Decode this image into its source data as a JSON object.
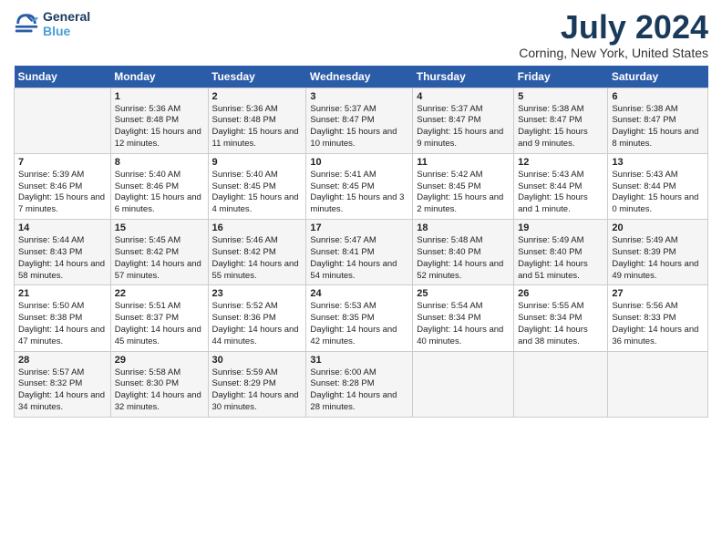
{
  "header": {
    "logo_line1": "General",
    "logo_line2": "Blue",
    "title": "July 2024",
    "subtitle": "Corning, New York, United States"
  },
  "days_of_week": [
    "Sunday",
    "Monday",
    "Tuesday",
    "Wednesday",
    "Thursday",
    "Friday",
    "Saturday"
  ],
  "weeks": [
    [
      {
        "day": "",
        "sunrise": "",
        "sunset": "",
        "daylight": ""
      },
      {
        "day": "1",
        "sunrise": "Sunrise: 5:36 AM",
        "sunset": "Sunset: 8:48 PM",
        "daylight": "Daylight: 15 hours and 12 minutes."
      },
      {
        "day": "2",
        "sunrise": "Sunrise: 5:36 AM",
        "sunset": "Sunset: 8:48 PM",
        "daylight": "Daylight: 15 hours and 11 minutes."
      },
      {
        "day": "3",
        "sunrise": "Sunrise: 5:37 AM",
        "sunset": "Sunset: 8:47 PM",
        "daylight": "Daylight: 15 hours and 10 minutes."
      },
      {
        "day": "4",
        "sunrise": "Sunrise: 5:37 AM",
        "sunset": "Sunset: 8:47 PM",
        "daylight": "Daylight: 15 hours and 9 minutes."
      },
      {
        "day": "5",
        "sunrise": "Sunrise: 5:38 AM",
        "sunset": "Sunset: 8:47 PM",
        "daylight": "Daylight: 15 hours and 9 minutes."
      },
      {
        "day": "6",
        "sunrise": "Sunrise: 5:38 AM",
        "sunset": "Sunset: 8:47 PM",
        "daylight": "Daylight: 15 hours and 8 minutes."
      }
    ],
    [
      {
        "day": "7",
        "sunrise": "Sunrise: 5:39 AM",
        "sunset": "Sunset: 8:46 PM",
        "daylight": "Daylight: 15 hours and 7 minutes."
      },
      {
        "day": "8",
        "sunrise": "Sunrise: 5:40 AM",
        "sunset": "Sunset: 8:46 PM",
        "daylight": "Daylight: 15 hours and 6 minutes."
      },
      {
        "day": "9",
        "sunrise": "Sunrise: 5:40 AM",
        "sunset": "Sunset: 8:45 PM",
        "daylight": "Daylight: 15 hours and 4 minutes."
      },
      {
        "day": "10",
        "sunrise": "Sunrise: 5:41 AM",
        "sunset": "Sunset: 8:45 PM",
        "daylight": "Daylight: 15 hours and 3 minutes."
      },
      {
        "day": "11",
        "sunrise": "Sunrise: 5:42 AM",
        "sunset": "Sunset: 8:45 PM",
        "daylight": "Daylight: 15 hours and 2 minutes."
      },
      {
        "day": "12",
        "sunrise": "Sunrise: 5:43 AM",
        "sunset": "Sunset: 8:44 PM",
        "daylight": "Daylight: 15 hours and 1 minute."
      },
      {
        "day": "13",
        "sunrise": "Sunrise: 5:43 AM",
        "sunset": "Sunset: 8:44 PM",
        "daylight": "Daylight: 15 hours and 0 minutes."
      }
    ],
    [
      {
        "day": "14",
        "sunrise": "Sunrise: 5:44 AM",
        "sunset": "Sunset: 8:43 PM",
        "daylight": "Daylight: 14 hours and 58 minutes."
      },
      {
        "day": "15",
        "sunrise": "Sunrise: 5:45 AM",
        "sunset": "Sunset: 8:42 PM",
        "daylight": "Daylight: 14 hours and 57 minutes."
      },
      {
        "day": "16",
        "sunrise": "Sunrise: 5:46 AM",
        "sunset": "Sunset: 8:42 PM",
        "daylight": "Daylight: 14 hours and 55 minutes."
      },
      {
        "day": "17",
        "sunrise": "Sunrise: 5:47 AM",
        "sunset": "Sunset: 8:41 PM",
        "daylight": "Daylight: 14 hours and 54 minutes."
      },
      {
        "day": "18",
        "sunrise": "Sunrise: 5:48 AM",
        "sunset": "Sunset: 8:40 PM",
        "daylight": "Daylight: 14 hours and 52 minutes."
      },
      {
        "day": "19",
        "sunrise": "Sunrise: 5:49 AM",
        "sunset": "Sunset: 8:40 PM",
        "daylight": "Daylight: 14 hours and 51 minutes."
      },
      {
        "day": "20",
        "sunrise": "Sunrise: 5:49 AM",
        "sunset": "Sunset: 8:39 PM",
        "daylight": "Daylight: 14 hours and 49 minutes."
      }
    ],
    [
      {
        "day": "21",
        "sunrise": "Sunrise: 5:50 AM",
        "sunset": "Sunset: 8:38 PM",
        "daylight": "Daylight: 14 hours and 47 minutes."
      },
      {
        "day": "22",
        "sunrise": "Sunrise: 5:51 AM",
        "sunset": "Sunset: 8:37 PM",
        "daylight": "Daylight: 14 hours and 45 minutes."
      },
      {
        "day": "23",
        "sunrise": "Sunrise: 5:52 AM",
        "sunset": "Sunset: 8:36 PM",
        "daylight": "Daylight: 14 hours and 44 minutes."
      },
      {
        "day": "24",
        "sunrise": "Sunrise: 5:53 AM",
        "sunset": "Sunset: 8:35 PM",
        "daylight": "Daylight: 14 hours and 42 minutes."
      },
      {
        "day": "25",
        "sunrise": "Sunrise: 5:54 AM",
        "sunset": "Sunset: 8:34 PM",
        "daylight": "Daylight: 14 hours and 40 minutes."
      },
      {
        "day": "26",
        "sunrise": "Sunrise: 5:55 AM",
        "sunset": "Sunset: 8:34 PM",
        "daylight": "Daylight: 14 hours and 38 minutes."
      },
      {
        "day": "27",
        "sunrise": "Sunrise: 5:56 AM",
        "sunset": "Sunset: 8:33 PM",
        "daylight": "Daylight: 14 hours and 36 minutes."
      }
    ],
    [
      {
        "day": "28",
        "sunrise": "Sunrise: 5:57 AM",
        "sunset": "Sunset: 8:32 PM",
        "daylight": "Daylight: 14 hours and 34 minutes."
      },
      {
        "day": "29",
        "sunrise": "Sunrise: 5:58 AM",
        "sunset": "Sunset: 8:30 PM",
        "daylight": "Daylight: 14 hours and 32 minutes."
      },
      {
        "day": "30",
        "sunrise": "Sunrise: 5:59 AM",
        "sunset": "Sunset: 8:29 PM",
        "daylight": "Daylight: 14 hours and 30 minutes."
      },
      {
        "day": "31",
        "sunrise": "Sunrise: 6:00 AM",
        "sunset": "Sunset: 8:28 PM",
        "daylight": "Daylight: 14 hours and 28 minutes."
      },
      {
        "day": "",
        "sunrise": "",
        "sunset": "",
        "daylight": ""
      },
      {
        "day": "",
        "sunrise": "",
        "sunset": "",
        "daylight": ""
      },
      {
        "day": "",
        "sunrise": "",
        "sunset": "",
        "daylight": ""
      }
    ]
  ]
}
